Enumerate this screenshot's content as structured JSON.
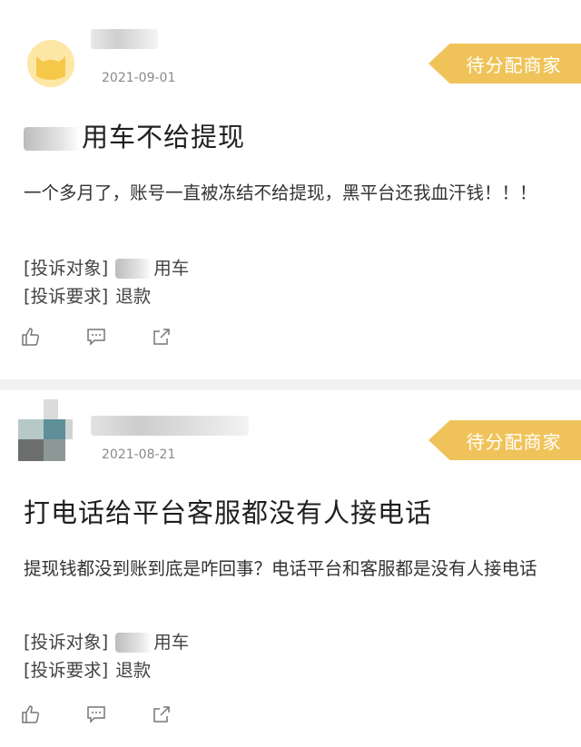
{
  "posts": [
    {
      "date": "2021-09-01",
      "status": "待分配商家",
      "title_suffix": "用车不给提现",
      "body": "一个多月了，账号一直被冻结不给提现，黑平台还我血汗钱！！！",
      "target_key": "[投诉对象]",
      "target_value": "用车",
      "demand_key": "[投诉要求]",
      "demand_value": "退款"
    },
    {
      "date": "2021-08-21",
      "status": "待分配商家",
      "title": "打电话给平台客服都没有人接电话",
      "body": "提现钱都没到账到底是咋回事？电话平台和客服都是没有人接电话",
      "target_key": "[投诉对象]",
      "target_value": "用车",
      "demand_key": "[投诉要求]",
      "demand_value": "退款"
    }
  ],
  "icons": [
    "thumb-up-icon",
    "comment-icon",
    "share-icon"
  ],
  "colors": {
    "badge": "#f0c35a",
    "avatar_cat": "#fde7a6",
    "separator": "#f2f2f2"
  }
}
